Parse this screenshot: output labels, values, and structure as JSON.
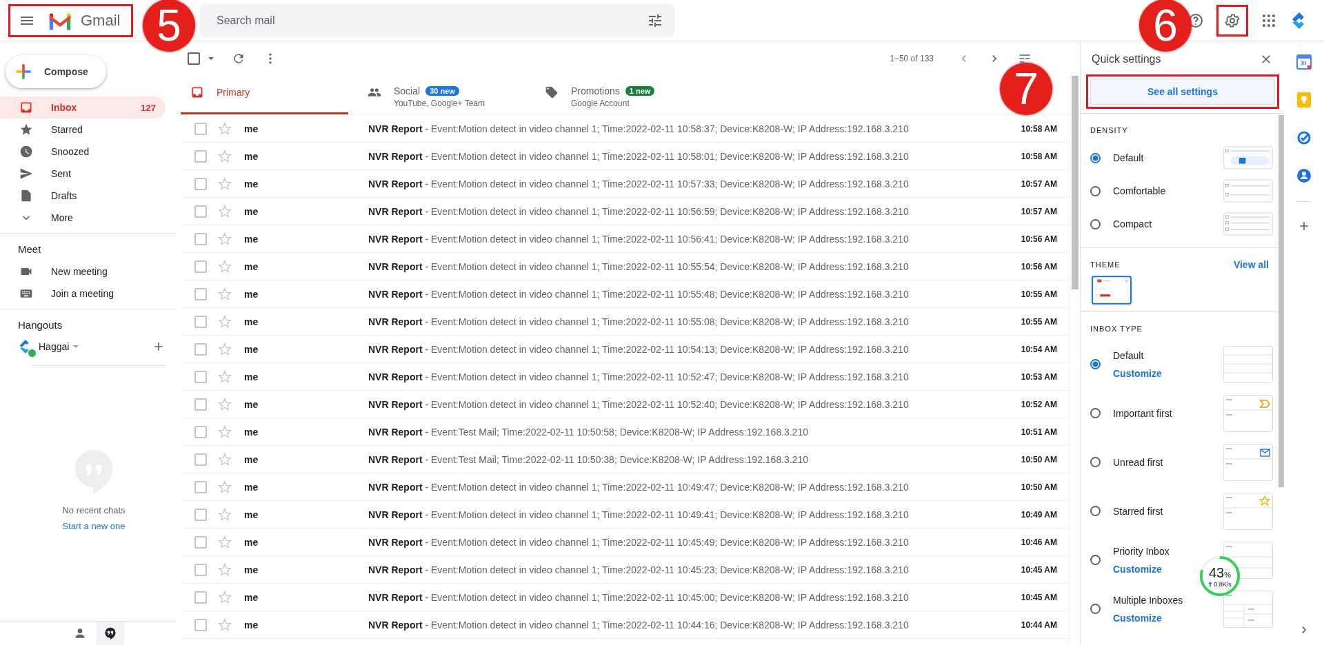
{
  "header": {
    "app_name": "Gmail",
    "logo_highlighted": true,
    "search": {
      "placeholder": "Search mail"
    },
    "settings_highlighted": true
  },
  "sidebar": {
    "compose": "Compose",
    "folders": [
      {
        "kind": "inbox",
        "label": "Inbox",
        "count": "127",
        "selected": true
      },
      {
        "kind": "star",
        "label": "Starred",
        "selected": false
      },
      {
        "kind": "clock",
        "label": "Snoozed",
        "selected": false
      },
      {
        "kind": "send",
        "label": "Sent",
        "selected": false
      },
      {
        "kind": "file",
        "label": "Drafts",
        "selected": false
      },
      {
        "kind": "chevron",
        "label": "More",
        "selected": false
      }
    ],
    "meet": {
      "title": "Meet",
      "items": [
        {
          "kind": "video",
          "label": "New meeting"
        },
        {
          "kind": "keyboard",
          "label": "Join a meeting"
        }
      ]
    },
    "hangouts": {
      "title": "Hangouts",
      "user": "Haggai",
      "online": true,
      "empty_text": "No recent chats",
      "start_link": "Start a new one"
    }
  },
  "toolbar": {
    "select_all_checked": false,
    "range": "1–50 of 133"
  },
  "tabs": [
    {
      "kind": "primary",
      "label": "Primary",
      "selected": true
    },
    {
      "kind": "social",
      "label": "Social",
      "badge": "30 new",
      "color": "#1a73e8",
      "subtitle": "YouTube, Google+ Team",
      "selected": false
    },
    {
      "kind": "promotions",
      "label": "Promotions",
      "badge": "1 new",
      "color": "#188038",
      "subtitle": "Google Account",
      "selected": false
    }
  ],
  "emails": [
    {
      "sender": "me",
      "subject": "NVR Report",
      "snippet": " - Event:Motion detect in video channel 1; Time:2022-02-11 10:58:37; Device:K8208-W; IP Address:192.168.3.210",
      "time": "10:58 AM",
      "unread": true
    },
    {
      "sender": "me",
      "subject": "NVR Report",
      "snippet": " - Event:Motion detect in video channel 1; Time:2022-02-11 10:58:01; Device:K8208-W; IP Address:192.168.3.210",
      "time": "10:58 AM",
      "unread": true
    },
    {
      "sender": "me",
      "subject": "NVR Report",
      "snippet": " - Event:Motion detect in video channel 1; Time:2022-02-11 10:57:33; Device:K8208-W; IP Address:192.168.3.210",
      "time": "10:57 AM",
      "unread": true
    },
    {
      "sender": "me",
      "subject": "NVR Report",
      "snippet": " - Event:Motion detect in video channel 1; Time:2022-02-11 10:56:59; Device:K8208-W; IP Address:192.168.3.210",
      "time": "10:57 AM",
      "unread": true
    },
    {
      "sender": "me",
      "subject": "NVR Report",
      "snippet": " - Event:Motion detect in video channel 1; Time:2022-02-11 10:56:41; Device:K8208-W; IP Address:192.168.3.210",
      "time": "10:56 AM",
      "unread": true
    },
    {
      "sender": "me",
      "subject": "NVR Report",
      "snippet": " - Event:Motion detect in video channel 1; Time:2022-02-11 10:55:54; Device:K8208-W; IP Address:192.168.3.210",
      "time": "10:56 AM",
      "unread": true
    },
    {
      "sender": "me",
      "subject": "NVR Report",
      "snippet": " - Event:Motion detect in video channel 1; Time:2022-02-11 10:55:48; Device:K8208-W; IP Address:192.168.3.210",
      "time": "10:55 AM",
      "unread": true
    },
    {
      "sender": "me",
      "subject": "NVR Report",
      "snippet": " - Event:Motion detect in video channel 1; Time:2022-02-11 10:55:08; Device:K8208-W; IP Address:192.168.3.210",
      "time": "10:55 AM",
      "unread": true
    },
    {
      "sender": "me",
      "subject": "NVR Report",
      "snippet": " - Event:Motion detect in video channel 1; Time:2022-02-11 10:54:13; Device:K8208-W; IP Address:192.168.3.210",
      "time": "10:54 AM",
      "unread": true
    },
    {
      "sender": "me",
      "subject": "NVR Report",
      "snippet": " - Event:Motion detect in video channel 1; Time:2022-02-11 10:52:47; Device:K8208-W; IP Address:192.168.3.210",
      "time": "10:53 AM",
      "unread": true
    },
    {
      "sender": "me",
      "subject": "NVR Report",
      "snippet": " - Event:Motion detect in video channel 1; Time:2022-02-11 10:52:40; Device:K8208-W; IP Address:192.168.3.210",
      "time": "10:52 AM",
      "unread": true
    },
    {
      "sender": "me",
      "subject": "NVR Report",
      "snippet": " - Event:Test Mail; Time:2022-02-11 10:50:58; Device:K8208-W; IP Address:192.168.3.210",
      "time": "10:51 AM",
      "unread": true
    },
    {
      "sender": "me",
      "subject": "NVR Report",
      "snippet": " - Event:Test Mail; Time:2022-02-11 10:50:38; Device:K8208-W; IP Address:192.168.3.210",
      "time": "10:50 AM",
      "unread": true
    },
    {
      "sender": "me",
      "subject": "NVR Report",
      "snippet": " - Event:Motion detect in video channel 1; Time:2022-02-11 10:49:47; Device:K8208-W; IP Address:192.168.3.210",
      "time": "10:50 AM",
      "unread": true
    },
    {
      "sender": "me",
      "subject": "NVR Report",
      "snippet": " - Event:Motion detect in video channel 1; Time:2022-02-11 10:49:41; Device:K8208-W; IP Address:192.168.3.210",
      "time": "10:49 AM",
      "unread": true
    },
    {
      "sender": "me",
      "subject": "NVR Report",
      "snippet": " - Event:Motion detect in video channel 1; Time:2022-02-11 10:45:49; Device:K8208-W; IP Address:192.168.3.210",
      "time": "10:46 AM",
      "unread": true
    },
    {
      "sender": "me",
      "subject": "NVR Report",
      "snippet": " - Event:Motion detect in video channel 1; Time:2022-02-11 10:45:23; Device:K8208-W; IP Address:192.168.3.210",
      "time": "10:45 AM",
      "unread": true
    },
    {
      "sender": "me",
      "subject": "NVR Report",
      "snippet": " - Event:Motion detect in video channel 1; Time:2022-02-11 10:45:00; Device:K8208-W; IP Address:192.168.3.210",
      "time": "10:45 AM",
      "unread": true
    },
    {
      "sender": "me",
      "subject": "NVR Report",
      "snippet": " - Event:Motion detect in video channel 1; Time:2022-02-11 10:44:16; Device:K8208-W; IP Address:192.168.3.210",
      "time": "10:44 AM",
      "unread": true
    }
  ],
  "quick_settings": {
    "title": "Quick settings",
    "see_all": "See all settings",
    "see_all_highlighted": true,
    "density": {
      "title": "DENSITY",
      "options": [
        {
          "kind": "default",
          "label": "Default",
          "selected": true
        },
        {
          "kind": "comfortable",
          "label": "Comfortable",
          "selected": false
        },
        {
          "kind": "compact",
          "label": "Compact",
          "selected": false
        }
      ]
    },
    "theme": {
      "title": "THEME",
      "view_all": "View all"
    },
    "inbox_type": {
      "title": "INBOX TYPE",
      "options": [
        {
          "kind": "default",
          "label": "Default",
          "customize": "Customize",
          "selected": true
        },
        {
          "kind": "important",
          "label": "Important first",
          "selected": false
        },
        {
          "kind": "unread",
          "label": "Unread first",
          "selected": false
        },
        {
          "kind": "starred",
          "label": "Starred first",
          "selected": false
        },
        {
          "kind": "priority",
          "label": "Priority Inbox",
          "customize": "Customize",
          "selected": false
        },
        {
          "kind": "multiple",
          "label": "Multiple Inboxes",
          "customize": "Customize",
          "selected": false
        }
      ]
    }
  },
  "speed_meter": {
    "percent": "43",
    "unit": "%",
    "rate": "0.8K/s"
  },
  "callouts": [
    {
      "label": "5"
    },
    {
      "label": "6"
    },
    {
      "label": "7"
    }
  ]
}
